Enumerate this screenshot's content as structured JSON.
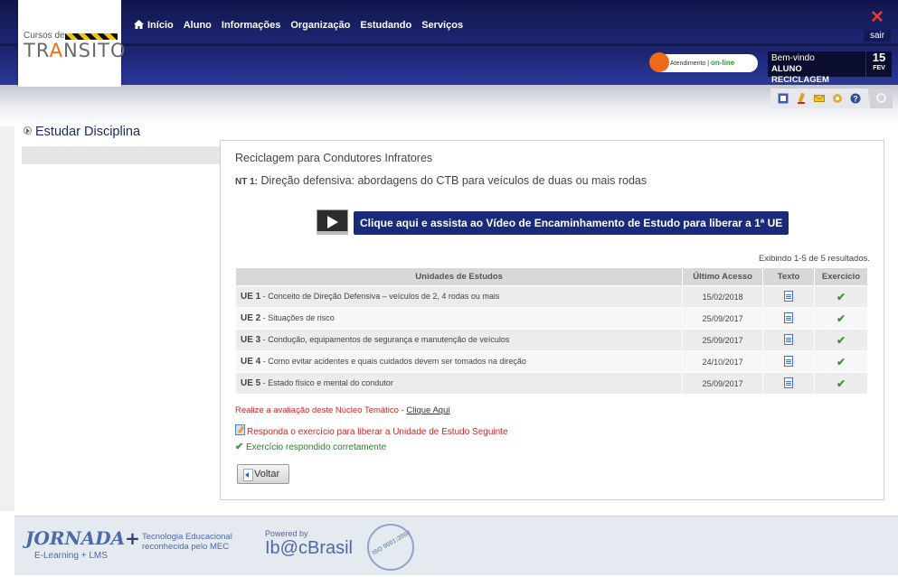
{
  "logo": {
    "small": "Cursos de",
    "big_pre": "TR",
    "big_cone": "A",
    "big_post": "NSITO"
  },
  "nav": {
    "items": [
      "Início",
      "Aluno",
      "Informações",
      "Organização",
      "Estudando",
      "Serviços"
    ]
  },
  "exit_label": "sair",
  "support": {
    "label": "Atendimento |",
    "status": "on-line"
  },
  "welcome": {
    "greeting": "Bem-vindo",
    "user": "ALUNO RECICLAGEM"
  },
  "date": {
    "day": "15",
    "month": "FEV"
  },
  "toolbar_icons": [
    "calculator-icon",
    "pencil-icon",
    "mail-icon",
    "settings-icon",
    "help-icon"
  ],
  "sidebar": {
    "title": "Estudar Disciplina"
  },
  "main": {
    "course_title": "Reciclagem para Condutores Infratores",
    "nt_label": "NT 1:",
    "nt_title": "Direção defensiva: abordagens do CTB para veículos de duas ou mais rodas",
    "video_button": "Clique aqui e assista ao Vídeo de Encaminhamento de Estudo para liberar a 1ª UE",
    "showing": "Exibindo 1-5 de 5 resultados.",
    "table": {
      "headers": [
        "Unidades de Estudos",
        "Último Acesso",
        "Texto",
        "Exercício"
      ],
      "rows": [
        {
          "code": "UE 1",
          "name": " - Conceito de Direção Defensiva – veículos de 2, 4 rodas ou mais",
          "date": "15/02/2018"
        },
        {
          "code": "UE 2",
          "name": " - Situações de risco",
          "date": "25/09/2017"
        },
        {
          "code": "UE 3",
          "name": " - Condução, equipamentos de segurança e manutenção de veículos",
          "date": "25/09/2017"
        },
        {
          "code": "UE 4",
          "name": " - Como evitar acidentes e quais cuidados devem ser tomados na direção",
          "date": "24/10/2017"
        },
        {
          "code": "UE 5",
          "name": " - Estado físico e mental do condutor",
          "date": "25/09/2017"
        }
      ]
    },
    "eval_text": "Realize a avaliação deste Núcleo Temático - ",
    "eval_link": "Clique Aqui",
    "legend_pending": "Responda o exercício para liberar a Unidade de Estudo Seguinte",
    "legend_done": "Exercício respondido corretamente",
    "back_button": "Voltar"
  },
  "footer": {
    "brand": "JORNADA",
    "brand_plus": "+",
    "brand_sub": "E-Learning + LMS",
    "tagline_1": "Tecnologia Educacional",
    "tagline_2": "reconhecida pelo MEC",
    "powered": "Powered by",
    "company": "Ib@cBrasil",
    "iso": "ISO 9001:2008"
  },
  "colors": {
    "header": "#1d2673",
    "accent_blue": "#1a2a7a",
    "alert_red": "#c62828",
    "ok_green": "#3a9a3a"
  }
}
